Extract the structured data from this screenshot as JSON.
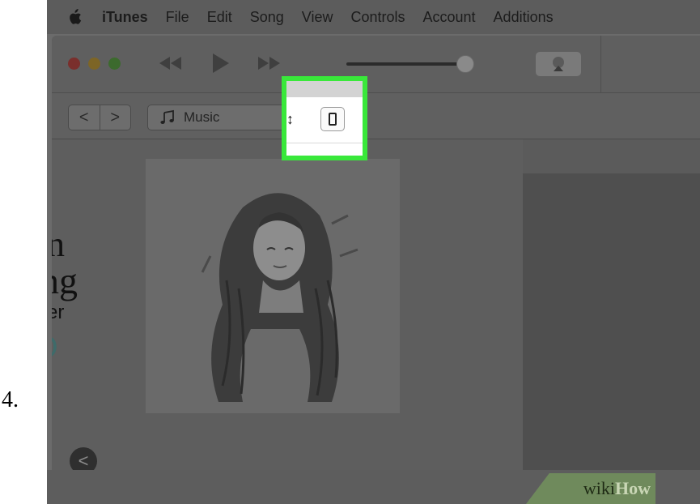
{
  "step": {
    "number": "4."
  },
  "menubar": {
    "apple_icon": "apple-logo-icon",
    "items": [
      "iTunes",
      "File",
      "Edit",
      "Song",
      "View",
      "Controls",
      "Account",
      "Additions"
    ]
  },
  "toolbar": {
    "icons": [
      "rewind-icon",
      "play-icon",
      "fast-forward-icon",
      "airplay-icon"
    ]
  },
  "navbar": {
    "back": "<",
    "forward": ">",
    "media_kind": "Music",
    "stepper": "↕"
  },
  "highlight": {
    "color": "#39e83a",
    "device_icon": "iphone-icon"
  },
  "content": {
    "fragment_1": "n",
    "fragment_2": "ng",
    "fragment_3": "er",
    "fragment_4": "O",
    "back_arrow": "<"
  },
  "watermark": {
    "wiki": "wiki",
    "how": "How"
  }
}
